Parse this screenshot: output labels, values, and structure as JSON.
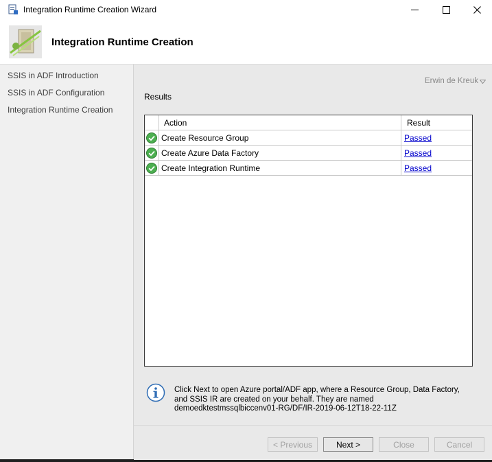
{
  "window": {
    "title": "Integration Runtime Creation Wizard"
  },
  "header": {
    "title": "Integration Runtime Creation"
  },
  "sidebar": {
    "items": [
      {
        "label": "SSIS in ADF Introduction"
      },
      {
        "label": "SSIS in ADF Configuration"
      },
      {
        "label": "Integration Runtime Creation"
      }
    ]
  },
  "user": {
    "name": "Erwin de Kreuk"
  },
  "results": {
    "label": "Results",
    "columns": {
      "action": "Action",
      "result": "Result"
    },
    "rows": [
      {
        "action": "Create Resource Group",
        "result": "Passed",
        "status_icon": "check-circle-icon"
      },
      {
        "action": "Create Azure Data Factory",
        "result": "Passed",
        "status_icon": "check-circle-icon"
      },
      {
        "action": "Create Integration Runtime",
        "result": "Passed",
        "status_icon": "check-circle-icon"
      }
    ]
  },
  "info": {
    "text": "Click Next to open Azure portal/ADF app, where a Resource Group, Data Factory, and SSIS IR are created on your behalf. They are named demoedktestmssqlbiccenv01-RG/DF/IR-2019-06-12T18-22-11Z"
  },
  "buttons": {
    "previous": "< Previous",
    "next": "Next >",
    "close": "Close",
    "cancel": "Cancel"
  },
  "colors": {
    "link": "#0000cc",
    "success": "#4caf50",
    "content_bg": "#e9e9e9",
    "sidebar_bg": "#f0f0f0"
  }
}
